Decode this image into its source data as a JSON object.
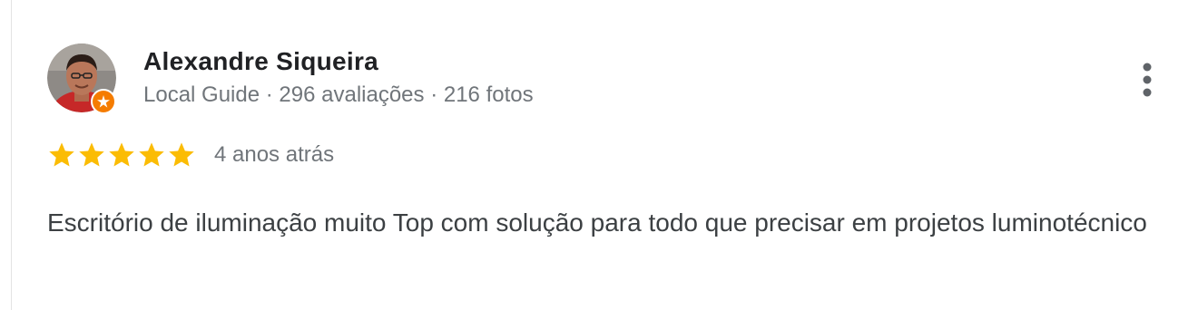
{
  "reviewer": {
    "name": "Alexandre Siqueira",
    "meta": "Local Guide · 296 avaliações · 216 fotos",
    "avatar_icon": "reviewer-avatar-photo",
    "badge_icon": "local-guide-badge-icon"
  },
  "rating": {
    "stars": 5,
    "max_stars": 5,
    "date": "4 anos atrás"
  },
  "review": {
    "text": "Escritório de iluminação muito Top com solução para todo que precisar em projetos luminotécnico"
  },
  "actions": {
    "more_icon": "more-vert-icon"
  },
  "colors": {
    "star": "#fbbc04",
    "badge": "#f57c00",
    "name": "#202124",
    "meta": "#70757a",
    "text": "#3c4043"
  }
}
